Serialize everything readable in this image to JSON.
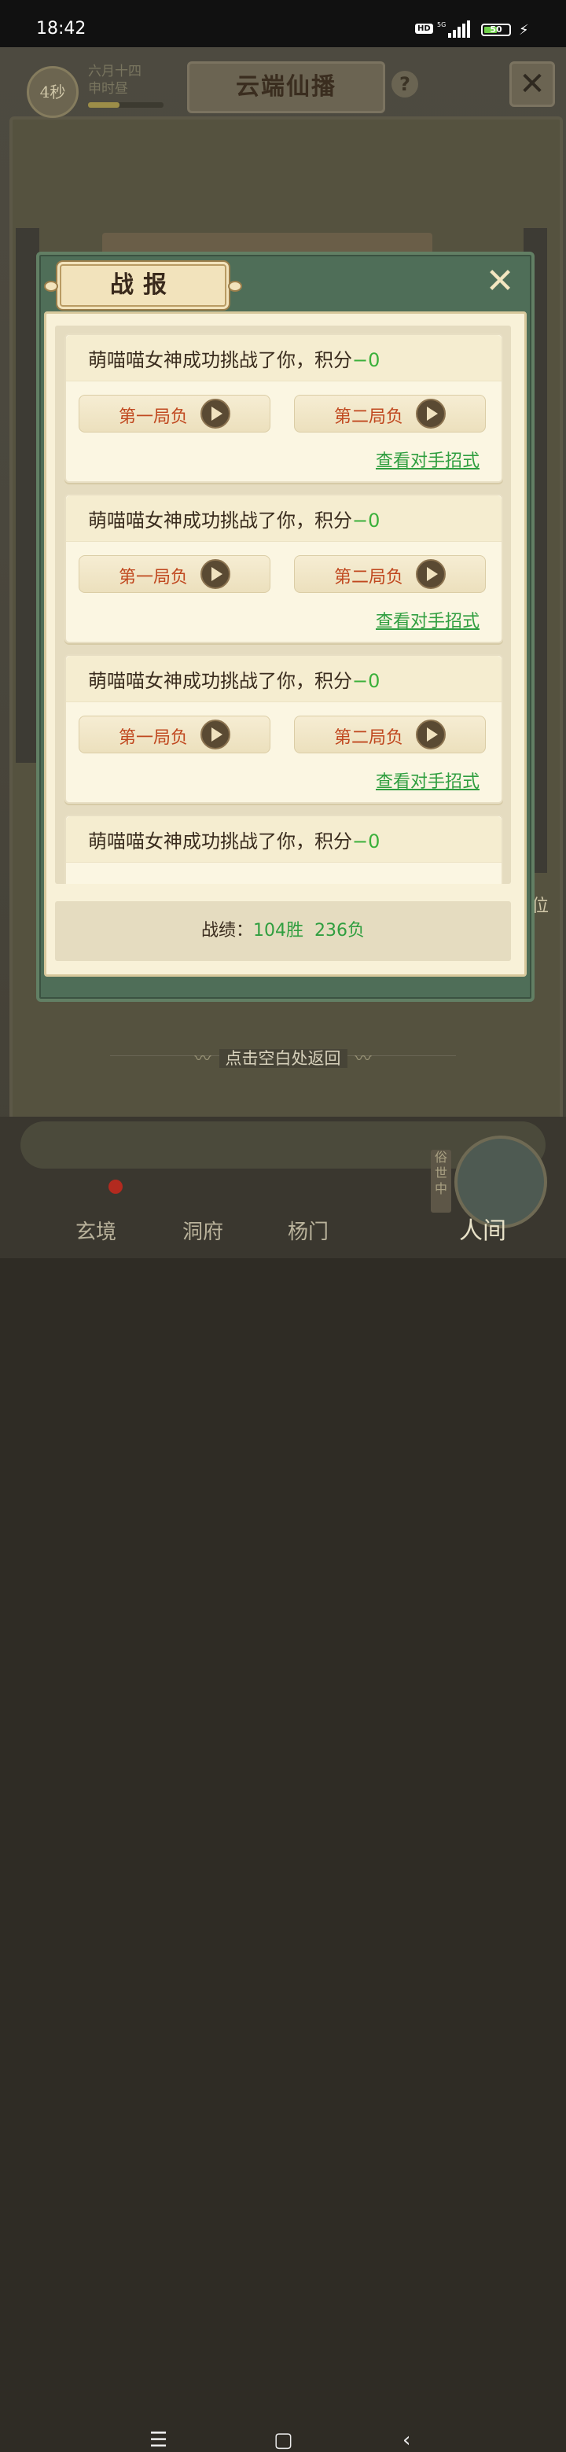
{
  "status_bar": {
    "time": "18:42",
    "hd": "HD",
    "network": "5G",
    "battery": "50"
  },
  "game": {
    "timer": "4秒",
    "date_line1": "六月十四",
    "date_line2": "申时昼",
    "title": "云端仙播",
    "help": "?",
    "side_char": "位",
    "back_hint": "点击空白处返回",
    "suzhong": "俗世中",
    "tabs": [
      "玄境",
      "洞府",
      "杨门",
      "人间"
    ]
  },
  "modal": {
    "title": "战报",
    "records": [
      {
        "text": "萌喵喵女神成功挑战了你，积分",
        "score": "−0",
        "round1": "第一局负",
        "round2": "第二局负",
        "link": "查看对手招式"
      },
      {
        "text": "萌喵喵女神成功挑战了你，积分",
        "score": "−0",
        "round1": "第一局负",
        "round2": "第二局负",
        "link": "查看对手招式"
      },
      {
        "text": "萌喵喵女神成功挑战了你，积分",
        "score": "−0",
        "round1": "第一局负",
        "round2": "第二局负",
        "link": "查看对手招式"
      },
      {
        "text": "萌喵喵女神成功挑战了你，积分",
        "score": "−0"
      }
    ],
    "summary_label": "战绩：",
    "wins": "104胜",
    "losses": "236负"
  },
  "colors": {
    "accent_green": "#2f9e3f",
    "round_red": "#c0481f",
    "modal_frame": "#4f6e58"
  }
}
